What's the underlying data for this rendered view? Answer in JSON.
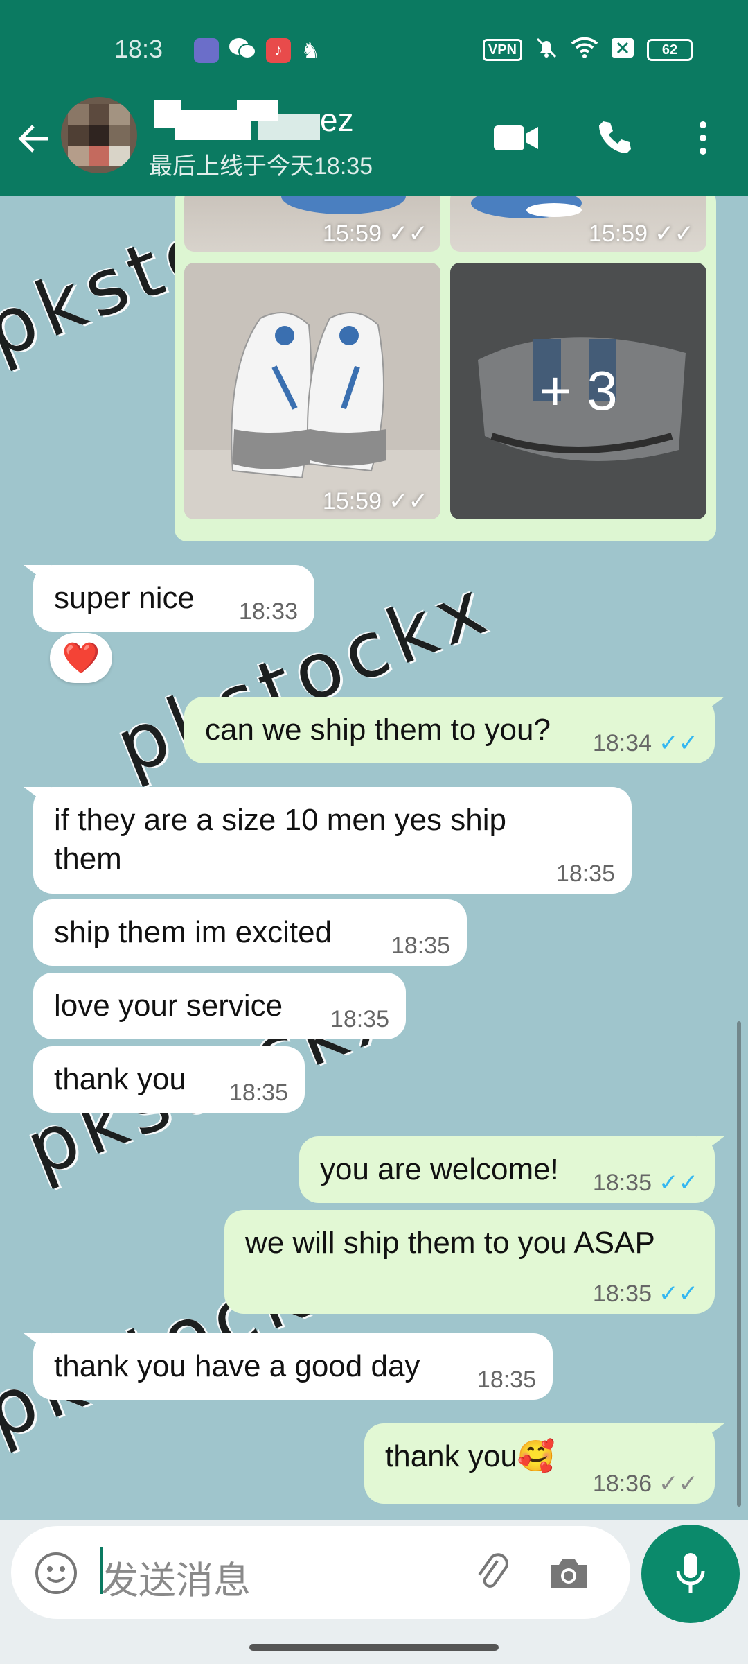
{
  "status_bar": {
    "time": "18:3",
    "vpn": "VPN",
    "battery": "62"
  },
  "header": {
    "contact_name": "ez",
    "last_seen": "最后上线于今天18:35"
  },
  "media_grid": {
    "tiles": [
      {
        "time": "15:59"
      },
      {
        "time": "15:59"
      },
      {
        "time": "15:59"
      },
      {
        "more": "+ 3"
      }
    ]
  },
  "messages": [
    {
      "text": "super nice",
      "time": "18:33",
      "direction": "in"
    },
    {
      "text": "can we ship them to you?",
      "time": "18:34",
      "direction": "out",
      "status": "read"
    },
    {
      "text": "if they are a size 10 men yes ship them",
      "time": "18:35",
      "direction": "in"
    },
    {
      "text": "ship them im excited",
      "time": "18:35",
      "direction": "in"
    },
    {
      "text": "love your service",
      "time": "18:35",
      "direction": "in"
    },
    {
      "text": "thank you",
      "time": "18:35",
      "direction": "in"
    },
    {
      "text": "you are welcome!",
      "time": "18:35",
      "direction": "out",
      "status": "read"
    },
    {
      "text": "we will ship them to you ASAP",
      "time": "18:35",
      "direction": "out",
      "status": "read"
    },
    {
      "text": "thank you have a good day",
      "time": "18:35",
      "direction": "in"
    },
    {
      "text": "thank you🥰",
      "time": "18:36",
      "direction": "out",
      "status": "delivered"
    }
  ],
  "reaction": "❤️",
  "watermark": "pkstockx",
  "input": {
    "placeholder": "发送消息"
  },
  "colors": {
    "header": "#0b7a61",
    "chat_bg": "#9fc5cc",
    "outgoing": "#e2f8d4",
    "read_tick": "#34b7f1"
  }
}
